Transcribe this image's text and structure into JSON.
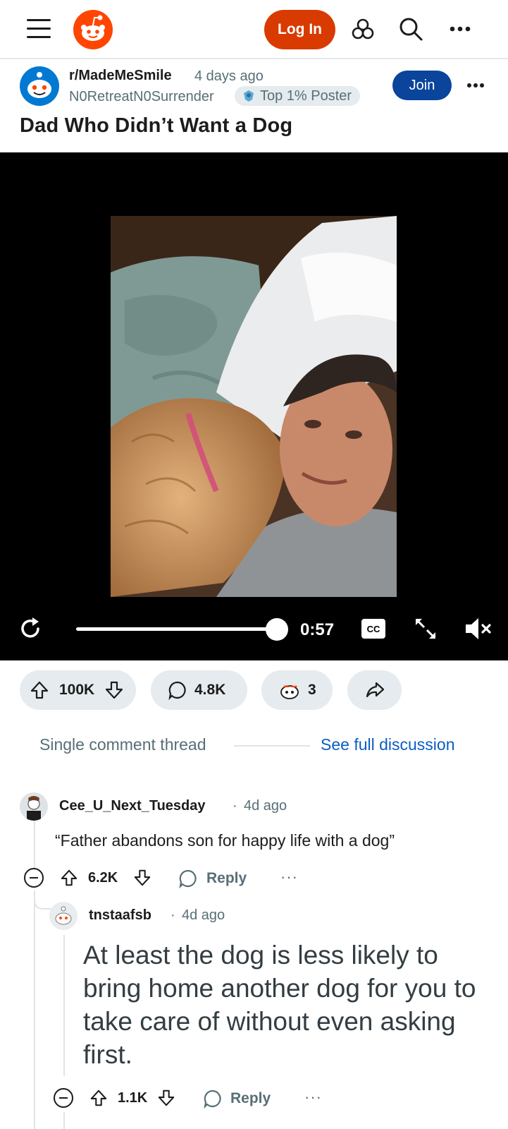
{
  "topbar": {
    "login_label": "Log In",
    "icons": [
      "menu-icon",
      "reddit-logo",
      "explore-icon",
      "search-icon",
      "more-icon"
    ],
    "accent": "#d93a00"
  },
  "post": {
    "subreddit": "r/MadeMeSmile",
    "age": "4 days ago",
    "author": "N0RetreatN0Surrender",
    "flair": "Top 1% Poster",
    "join_label": "Join",
    "title": "Dad Who Didn’t Want a Dog",
    "join_color": "#0a449b"
  },
  "video": {
    "time": "0:57",
    "cc_label": "CC",
    "progress": 0.98,
    "muted": true
  },
  "actions": {
    "votes": "100K",
    "comments": "4.8K",
    "awards": "3"
  },
  "thread": {
    "label": "Single comment thread",
    "see_full": "See full discussion"
  },
  "comments": [
    {
      "user": "Cee_U_Next_Tuesday",
      "sep": "·",
      "age": "4d ago",
      "text": "“Father abandons son for happy life with a dog”",
      "score": "6.2K",
      "reply_label": "Reply",
      "more": "···"
    },
    {
      "user": "tnstaafsb",
      "sep": "·",
      "age": "4d ago",
      "text": "At least the dog is less likely to bring home another dog for you to take care of without even asking first.",
      "score": "1.1K",
      "reply_label": "Reply",
      "more": "···"
    }
  ]
}
